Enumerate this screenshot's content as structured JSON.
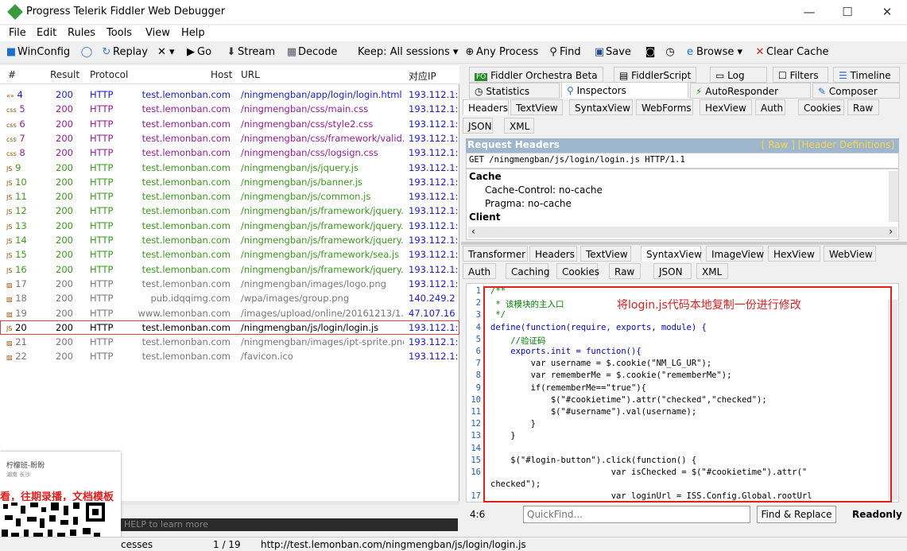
{
  "window": {
    "title": "Progress Telerik Fiddler Web Debugger",
    "min": "—",
    "max": "☐",
    "close": "✕"
  },
  "menu": [
    "File",
    "Edit",
    "Rules",
    "Tools",
    "View",
    "Help"
  ],
  "toolbar": {
    "winconfig": "WinConfig",
    "replay": "Replay",
    "remove": "✕ ▾",
    "go": "Go",
    "stream": "Stream",
    "decode": "Decode",
    "keep": "Keep: All sessions ▾",
    "process": "Any Process",
    "find": "Find",
    "save": "Save",
    "browse": "Browse",
    "clearcache": "Clear Cache"
  },
  "sessions": {
    "headers": [
      "#",
      "Result",
      "Protocol",
      "Host",
      "URL",
      "对应IP"
    ],
    "rows": [
      {
        "id": "4",
        "icon": "«»",
        "result": "200",
        "proto": "HTTP",
        "host": "test.lemonban.com",
        "url": "/ningmengban/app/login/login.html",
        "ip": "193.112.1:",
        "color": "#1a1acc"
      },
      {
        "id": "5",
        "icon": "css",
        "result": "200",
        "proto": "HTTP",
        "host": "test.lemonban.com",
        "url": "/ningmengban/css/main.css",
        "ip": "193.112.1:",
        "color": "#9a1a9a"
      },
      {
        "id": "6",
        "icon": "css",
        "result": "200",
        "proto": "HTTP",
        "host": "test.lemonban.com",
        "url": "/ningmengban/css/style2.css",
        "ip": "193.112.1:",
        "color": "#9a1a9a"
      },
      {
        "id": "7",
        "icon": "css",
        "result": "200",
        "proto": "HTTP",
        "host": "test.lemonban.com",
        "url": "/ningmengban/css/framework/valid...",
        "ip": "193.112.1:",
        "color": "#9a1a9a"
      },
      {
        "id": "8",
        "icon": "css",
        "result": "200",
        "proto": "HTTP",
        "host": "test.lemonban.com",
        "url": "/ningmengban/css/logsign.css",
        "ip": "193.112.1:",
        "color": "#9a1a9a"
      },
      {
        "id": "9",
        "icon": "js",
        "result": "200",
        "proto": "HTTP",
        "host": "test.lemonban.com",
        "url": "/ningmengban/js/jquery.js",
        "ip": "193.112.1:",
        "color": "#3a9a1a"
      },
      {
        "id": "10",
        "icon": "js",
        "result": "200",
        "proto": "HTTP",
        "host": "test.lemonban.com",
        "url": "/ningmengban/js/banner.js",
        "ip": "193.112.1:",
        "color": "#3a9a1a"
      },
      {
        "id": "11",
        "icon": "js",
        "result": "200",
        "proto": "HTTP",
        "host": "test.lemonban.com",
        "url": "/ningmengban/js/common.js",
        "ip": "193.112.1:",
        "color": "#3a9a1a"
      },
      {
        "id": "12",
        "icon": "js",
        "result": "200",
        "proto": "HTTP",
        "host": "test.lemonban.com",
        "url": "/ningmengban/js/framework/jquery....",
        "ip": "193.112.1:",
        "color": "#3a9a1a"
      },
      {
        "id": "13",
        "icon": "js",
        "result": "200",
        "proto": "HTTP",
        "host": "test.lemonban.com",
        "url": "/ningmengban/js/framework/jquery....",
        "ip": "193.112.1:",
        "color": "#3a9a1a"
      },
      {
        "id": "14",
        "icon": "js",
        "result": "200",
        "proto": "HTTP",
        "host": "test.lemonban.com",
        "url": "/ningmengban/js/framework/jquery....",
        "ip": "193.112.1:",
        "color": "#3a9a1a"
      },
      {
        "id": "15",
        "icon": "js",
        "result": "200",
        "proto": "HTTP",
        "host": "test.lemonban.com",
        "url": "/ningmengban/js/framework/sea.js",
        "ip": "193.112.1:",
        "color": "#3a9a1a"
      },
      {
        "id": "16",
        "icon": "js",
        "result": "200",
        "proto": "HTTP",
        "host": "test.lemonban.com",
        "url": "/ningmengban/js/framework/jquery....",
        "ip": "193.112.1:",
        "color": "#3a9a1a"
      },
      {
        "id": "17",
        "icon": "img",
        "result": "200",
        "proto": "HTTP",
        "host": "test.lemonban.com",
        "url": "/ningmengban/images/logo.png",
        "ip": "193.112.1:",
        "color": "#777777"
      },
      {
        "id": "18",
        "icon": "img",
        "result": "200",
        "proto": "HTTP",
        "host": "pub.idqqimg.com",
        "url": "/wpa/images/group.png",
        "ip": "140.249.2",
        "color": "#777777"
      },
      {
        "id": "19",
        "icon": "img",
        "result": "200",
        "proto": "HTTP",
        "host": "www.lemonban.com",
        "url": "/images/upload/online/20161213/1...",
        "ip": "47.107.16",
        "color": "#777777"
      },
      {
        "id": "20",
        "icon": "js",
        "result": "200",
        "proto": "HTTP",
        "host": "test.lemonban.com",
        "url": "/ningmengban/js/login/login.js",
        "ip": "193.112.1:",
        "color": "#000000"
      },
      {
        "id": "21",
        "icon": "img",
        "result": "200",
        "proto": "HTTP",
        "host": "test.lemonban.com",
        "url": "/ningmengban/images/ipt-sprite.png",
        "ip": "193.112.1:",
        "color": "#777777"
      },
      {
        "id": "22",
        "icon": "img",
        "result": "200",
        "proto": "HTTP",
        "host": "test.lemonban.com",
        "url": "/favicon.ico",
        "ip": "193.112.1:",
        "color": "#777777"
      }
    ]
  },
  "tabs_top": [
    "Fiddler Orchestra Beta",
    "FiddlerScript",
    "Log",
    "Filters",
    "Timeline"
  ],
  "tabs_second": [
    "Statistics",
    "Inspectors",
    "AutoResponder",
    "Composer"
  ],
  "req_tabs": [
    "Headers",
    "TextView",
    "SyntaxView",
    "WebForms",
    "HexView",
    "Auth",
    "Cookies",
    "Raw"
  ],
  "req_tabs2": [
    "JSON",
    "XML"
  ],
  "request_headers": {
    "title": "Request Headers",
    "links": "[ Raw ]   [Header Definitions]",
    "request_line": "GET /ningmengban/js/login/login.js HTTP/1.1",
    "groups": [
      {
        "name": "Cache",
        "items": [
          "Cache-Control: no-cache",
          "Pragma: no-cache"
        ]
      },
      {
        "name": "Client",
        "items": []
      }
    ]
  },
  "resp_tabs": [
    "Transformer",
    "Headers",
    "TextView",
    "SyntaxView",
    "ImageView",
    "HexView",
    "WebView"
  ],
  "resp_tabs2": [
    "Auth",
    "Caching",
    "Cookies",
    "Raw",
    "JSON",
    "XML"
  ],
  "code": {
    "lines": [
      {
        "n": "1",
        "t": "/**",
        "c": "cm"
      },
      {
        "n": "2",
        "t": " * 该模块的主入口",
        "c": "cm"
      },
      {
        "n": "3",
        "t": " */",
        "c": "cm"
      },
      {
        "n": "4",
        "t": "define(function(require, exports, module) {",
        "c": "kw"
      },
      {
        "n": "5",
        "t": "    //验证码",
        "c": "cm"
      },
      {
        "n": "6",
        "t": "    exports.init = function(){",
        "c": "kw"
      },
      {
        "n": "7",
        "t": "        var username = $.cookie(\"NM_LG_UR\");",
        "c": "fn"
      },
      {
        "n": "8",
        "t": "        var rememberMe = $.cookie(\"rememberMe\");",
        "c": "fn"
      },
      {
        "n": "9",
        "t": "        if(rememberMe==\"true\"){",
        "c": "fn"
      },
      {
        "n": "10",
        "t": "            $(\"#cookietime\").attr(\"checked\",\"checked\");",
        "c": "fn"
      },
      {
        "n": "11",
        "t": "            $(\"#username\").val(username);",
        "c": "fn"
      },
      {
        "n": "12",
        "t": "        }",
        "c": "fn"
      },
      {
        "n": "13",
        "t": "    }",
        "c": "fn"
      },
      {
        "n": "14",
        "t": "",
        "c": "fn"
      },
      {
        "n": "15",
        "t": "    $(\"#login-button\").click(function() {",
        "c": "fn"
      },
      {
        "n": "16",
        "t": "                        var isChecked = $(\"#cookietime\").attr(\"",
        "c": "fn"
      },
      {
        "n": "",
        "t": "checked\");",
        "c": "fn"
      },
      {
        "n": "17",
        "t": "                        var loginUrl = ISS.Config.Global.rootUrl",
        "c": "fn"
      }
    ]
  },
  "annotation": "将login.js代码本地复制一份进行修改",
  "bottom": {
    "position": "4:6",
    "quickfind_placeholder": "QuickFind...",
    "find_replace": "Find & Replace",
    "readonly": "Readonly"
  },
  "status": {
    "processes": "cesses",
    "count": "1 / 19",
    "url": "http://test.lemonban.com/ningmengban/js/login/login.js",
    "quickexec": "HELP to learn more"
  },
  "overlay": {
    "name": "柠檬班-盼盼",
    "sub": "湖南 长沙",
    "promo": "看，往期录播，文档模板"
  }
}
